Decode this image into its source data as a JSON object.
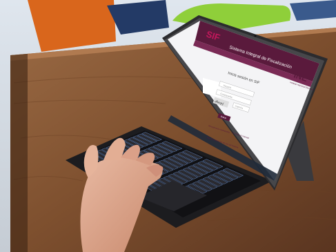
{
  "photo": {
    "subject": "tablet-on-table",
    "colors": {
      "table": "#8a5a36",
      "table_dark": "#4a2c18",
      "tablet_body": "#2b2b2e",
      "screen_header": "#5a1a3c",
      "keyboard": "#1c1c1f",
      "key_glow": "#7fb0ff",
      "chair_orange": "#d9661c",
      "chair_green": "#8fcf3a",
      "skin": "#d9a38a"
    }
  },
  "screen": {
    "brand_logo": "SIF",
    "header_title": "Sistema Integral de Fiscalización",
    "ine_logo": "INE",
    "ine_subtitle": "Instituto Nacional Electoral",
    "login_heading": "Inicia sesión en SIF",
    "user_placeholder": "Usuario",
    "password_placeholder": "Contraseña",
    "captcha_text": "dheqxj",
    "captcha_placeholder": "Captcha",
    "submit_label": "Entrar",
    "link_left": "Recupera tu contraseña",
    "link_right": "Consulta el manual",
    "footer_note": "Recomendaciones de uso del sistema"
  }
}
